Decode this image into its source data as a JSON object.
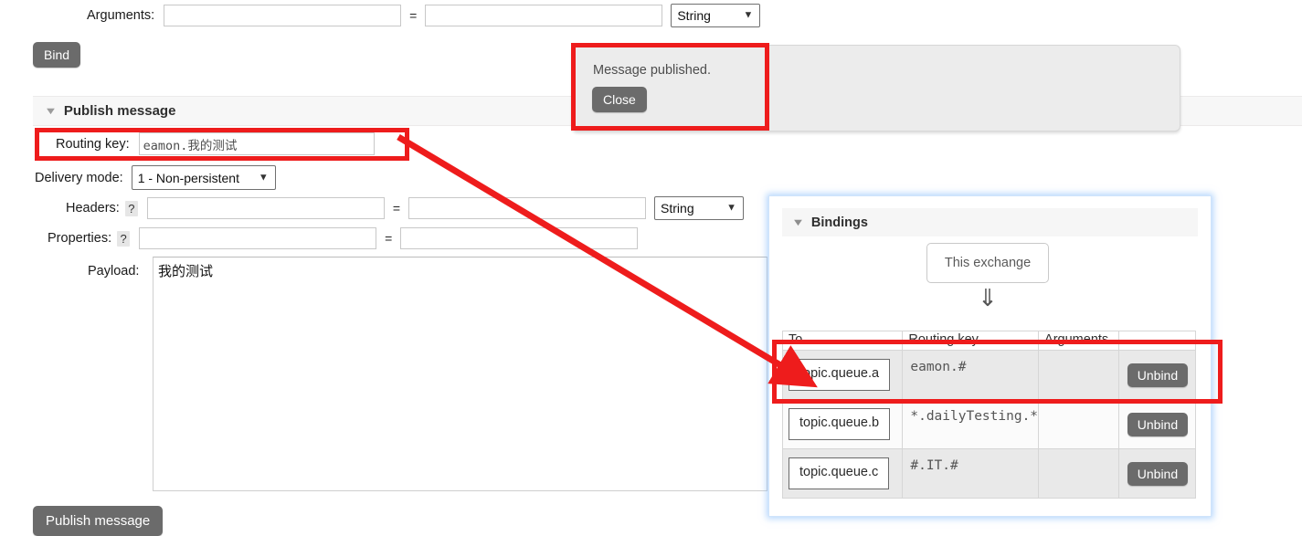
{
  "bind_form": {
    "arguments_label": "Arguments:",
    "arguments_key": "",
    "arguments_value": "",
    "equals": "=",
    "type_select": "String",
    "bind_button": "Bind"
  },
  "notification": {
    "message": "Message published.",
    "close_label": "Close"
  },
  "publish_section": {
    "title": "Publish message",
    "routing_key_label": "Routing key:",
    "routing_key_value": "eamon.我的测试",
    "delivery_mode_label": "Delivery mode:",
    "delivery_mode_value": "1 - Non-persistent",
    "headers_label": "Headers:",
    "headers_help": "?",
    "headers_key": "",
    "headers_value": "",
    "headers_type": "String",
    "properties_label": "Properties:",
    "properties_help": "?",
    "properties_key": "",
    "properties_value": "",
    "payload_label": "Payload:",
    "payload_value": "我的测试",
    "equals": "=",
    "publish_button": "Publish message"
  },
  "bindings_panel": {
    "title": "Bindings",
    "this_exchange_label": "This exchange",
    "flow_arrow": "⇓",
    "columns": [
      "To",
      "Routing key",
      "Arguments",
      ""
    ],
    "rows": [
      {
        "to": "topic.queue.a",
        "routing_key": "eamon.#",
        "arguments": "",
        "action": "Unbind"
      },
      {
        "to": "topic.queue.b",
        "routing_key": "*.dailyTesting.*",
        "arguments": "",
        "action": "Unbind"
      },
      {
        "to": "topic.queue.c",
        "routing_key": "#.IT.#",
        "arguments": "",
        "action": "Unbind"
      }
    ]
  },
  "annotations": {
    "highlight_color": "#ee1c1c",
    "arrow_color": "#ee1c1c",
    "boxes": [
      "routing-key-row",
      "message-published-popup",
      "first-binding-row"
    ],
    "arrow": "routing-key-to-first-binding"
  },
  "theme": {
    "button_bg": "#6b6b6b",
    "panel_glow": "#78b4fa",
    "band_bg": "#f7f7f7"
  }
}
